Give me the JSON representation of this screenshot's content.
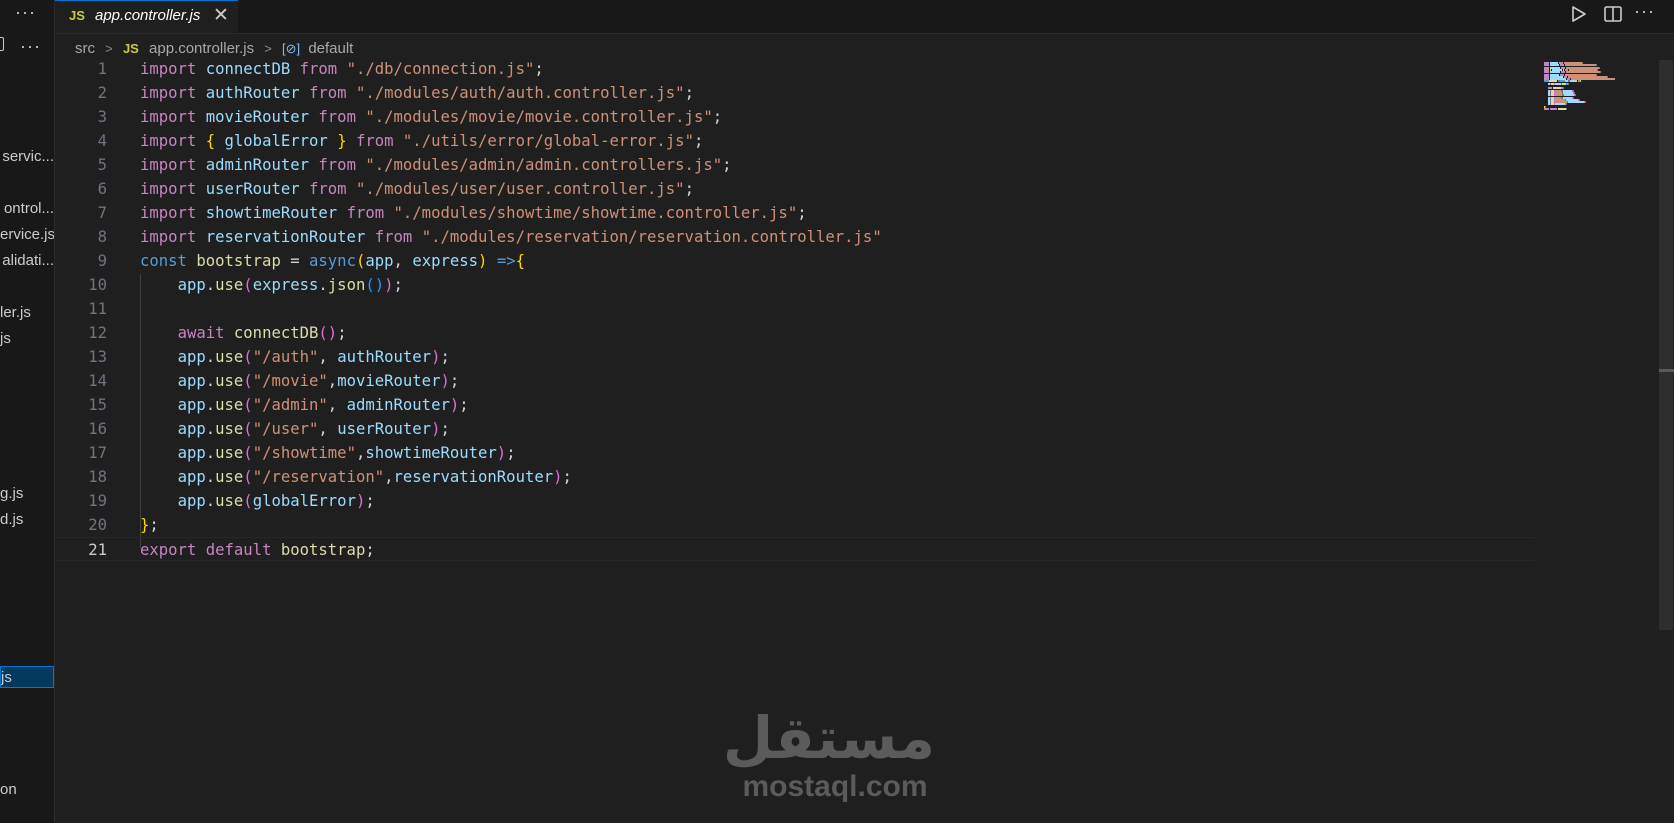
{
  "sidebar": {
    "menu_icon": "ellipsis-icon",
    "items": [
      {
        "label": "servic..."
      },
      {
        "label": "ontrol..."
      },
      {
        "label": "ervice.js"
      },
      {
        "label": "alidati..."
      },
      {
        "label": "ler.js"
      },
      {
        "label": "js"
      },
      {
        "label": "g.js"
      },
      {
        "label": "d.js"
      },
      {
        "label": "js"
      },
      {
        "label": "on"
      }
    ]
  },
  "tab": {
    "icon": "js-file-icon",
    "icon_label": "JS",
    "title": "app.controller.js",
    "close_icon": "close-icon"
  },
  "toolbar": {
    "run_icon": "play-icon",
    "split_icon": "split-editor-icon",
    "more_icon": "ellipsis-icon"
  },
  "breadcrumb": {
    "folder": "src",
    "file_icon_label": "JS",
    "file": "app.controller.js",
    "symbol_icon": "symbol-variable-icon",
    "symbol_glyph": "[⊘]",
    "symbol": "default"
  },
  "editor": {
    "current_line": 21,
    "lines": [
      {
        "n": "1",
        "tokens": [
          [
            "kw",
            "import"
          ],
          [
            "pl",
            " "
          ],
          [
            "var",
            "connectDB"
          ],
          [
            "pl",
            " "
          ],
          [
            "kw",
            "from"
          ],
          [
            "pl",
            " "
          ],
          [
            "str",
            "\"./db/connection.js\""
          ],
          [
            "pl",
            ";"
          ]
        ]
      },
      {
        "n": "2",
        "tokens": [
          [
            "kw",
            "import"
          ],
          [
            "pl",
            " "
          ],
          [
            "var",
            "authRouter"
          ],
          [
            "pl",
            " "
          ],
          [
            "kw",
            "from"
          ],
          [
            "pl",
            " "
          ],
          [
            "str",
            "\"./modules/auth/auth.controller.js\""
          ],
          [
            "pl",
            ";"
          ]
        ]
      },
      {
        "n": "3",
        "tokens": [
          [
            "kw",
            "import"
          ],
          [
            "pl",
            " "
          ],
          [
            "var",
            "movieRouter"
          ],
          [
            "pl",
            " "
          ],
          [
            "kw",
            "from"
          ],
          [
            "pl",
            " "
          ],
          [
            "str",
            "\"./modules/movie/movie.controller.js\""
          ],
          [
            "pl",
            ";"
          ]
        ]
      },
      {
        "n": "4",
        "tokens": [
          [
            "kw",
            "import"
          ],
          [
            "pl",
            " "
          ],
          [
            "p1",
            "{"
          ],
          [
            "pl",
            " "
          ],
          [
            "var",
            "globalError"
          ],
          [
            "pl",
            " "
          ],
          [
            "p1",
            "}"
          ],
          [
            "pl",
            " "
          ],
          [
            "kw",
            "from"
          ],
          [
            "pl",
            " "
          ],
          [
            "str",
            "\"./utils/error/global-error.js\""
          ],
          [
            "pl",
            ";"
          ]
        ]
      },
      {
        "n": "5",
        "tokens": [
          [
            "kw",
            "import"
          ],
          [
            "pl",
            " "
          ],
          [
            "var",
            "adminRouter"
          ],
          [
            "pl",
            " "
          ],
          [
            "kw",
            "from"
          ],
          [
            "pl",
            " "
          ],
          [
            "str",
            "\"./modules/admin/admin.controllers.js\""
          ],
          [
            "pl",
            ";"
          ]
        ]
      },
      {
        "n": "6",
        "tokens": [
          [
            "kw",
            "import"
          ],
          [
            "pl",
            " "
          ],
          [
            "var",
            "userRouter"
          ],
          [
            "pl",
            " "
          ],
          [
            "kw",
            "from"
          ],
          [
            "pl",
            " "
          ],
          [
            "str",
            "\"./modules/user/user.controller.js\""
          ],
          [
            "pl",
            ";"
          ]
        ]
      },
      {
        "n": "7",
        "tokens": [
          [
            "kw",
            "import"
          ],
          [
            "pl",
            " "
          ],
          [
            "var",
            "showtimeRouter"
          ],
          [
            "pl",
            " "
          ],
          [
            "kw",
            "from"
          ],
          [
            "pl",
            " "
          ],
          [
            "str",
            "\"./modules/showtime/showtime.controller.js\""
          ],
          [
            "pl",
            ";"
          ]
        ]
      },
      {
        "n": "8",
        "tokens": [
          [
            "kw",
            "import"
          ],
          [
            "pl",
            " "
          ],
          [
            "var",
            "reservationRouter"
          ],
          [
            "pl",
            " "
          ],
          [
            "kw",
            "from"
          ],
          [
            "pl",
            " "
          ],
          [
            "str",
            "\"./modules/reservation/reservation.controller.js\""
          ]
        ]
      },
      {
        "n": "9",
        "tokens": [
          [
            "dk",
            "const"
          ],
          [
            "pl",
            " "
          ],
          [
            "fn",
            "bootstrap"
          ],
          [
            "pl",
            " = "
          ],
          [
            "dk",
            "async"
          ],
          [
            "p1",
            "("
          ],
          [
            "var",
            "app"
          ],
          [
            "pl",
            ", "
          ],
          [
            "var",
            "express"
          ],
          [
            "p1",
            ")"
          ],
          [
            "pl",
            " "
          ],
          [
            "dk",
            "=>"
          ],
          [
            "p1",
            "{"
          ]
        ]
      },
      {
        "n": "10",
        "tokens": [
          [
            "pl",
            "    "
          ],
          [
            "var",
            "app"
          ],
          [
            "pl",
            "."
          ],
          [
            "fn",
            "use"
          ],
          [
            "p2",
            "("
          ],
          [
            "var",
            "express"
          ],
          [
            "pl",
            "."
          ],
          [
            "fn",
            "json"
          ],
          [
            "p3",
            "()"
          ],
          [
            "p2",
            ")"
          ],
          [
            "pl",
            ";"
          ]
        ]
      },
      {
        "n": "11",
        "tokens": []
      },
      {
        "n": "12",
        "tokens": [
          [
            "pl",
            "    "
          ],
          [
            "kw",
            "await"
          ],
          [
            "pl",
            " "
          ],
          [
            "fn",
            "connectDB"
          ],
          [
            "p2",
            "()"
          ],
          [
            "pl",
            ";"
          ]
        ]
      },
      {
        "n": "13",
        "tokens": [
          [
            "pl",
            "    "
          ],
          [
            "var",
            "app"
          ],
          [
            "pl",
            "."
          ],
          [
            "fn",
            "use"
          ],
          [
            "p2",
            "("
          ],
          [
            "str",
            "\"/auth\""
          ],
          [
            "pl",
            ", "
          ],
          [
            "var",
            "authRouter"
          ],
          [
            "p2",
            ")"
          ],
          [
            "pl",
            ";"
          ]
        ]
      },
      {
        "n": "14",
        "tokens": [
          [
            "pl",
            "    "
          ],
          [
            "var",
            "app"
          ],
          [
            "pl",
            "."
          ],
          [
            "fn",
            "use"
          ],
          [
            "p2",
            "("
          ],
          [
            "str",
            "\"/movie\""
          ],
          [
            "pl",
            ","
          ],
          [
            "var",
            "movieRouter"
          ],
          [
            "p2",
            ")"
          ],
          [
            "pl",
            ";"
          ]
        ]
      },
      {
        "n": "15",
        "tokens": [
          [
            "pl",
            "    "
          ],
          [
            "var",
            "app"
          ],
          [
            "pl",
            "."
          ],
          [
            "fn",
            "use"
          ],
          [
            "p2",
            "("
          ],
          [
            "str",
            "\"/admin\""
          ],
          [
            "pl",
            ", "
          ],
          [
            "var",
            "adminRouter"
          ],
          [
            "p2",
            ")"
          ],
          [
            "pl",
            ";"
          ]
        ]
      },
      {
        "n": "16",
        "tokens": [
          [
            "pl",
            "    "
          ],
          [
            "var",
            "app"
          ],
          [
            "pl",
            "."
          ],
          [
            "fn",
            "use"
          ],
          [
            "p2",
            "("
          ],
          [
            "str",
            "\"/user\""
          ],
          [
            "pl",
            ", "
          ],
          [
            "var",
            "userRouter"
          ],
          [
            "p2",
            ")"
          ],
          [
            "pl",
            ";"
          ]
        ]
      },
      {
        "n": "17",
        "tokens": [
          [
            "pl",
            "    "
          ],
          [
            "var",
            "app"
          ],
          [
            "pl",
            "."
          ],
          [
            "fn",
            "use"
          ],
          [
            "p2",
            "("
          ],
          [
            "str",
            "\"/showtime\""
          ],
          [
            "pl",
            ","
          ],
          [
            "var",
            "showtimeRouter"
          ],
          [
            "p2",
            ")"
          ],
          [
            "pl",
            ";"
          ]
        ]
      },
      {
        "n": "18",
        "tokens": [
          [
            "pl",
            "    "
          ],
          [
            "var",
            "app"
          ],
          [
            "pl",
            "."
          ],
          [
            "fn",
            "use"
          ],
          [
            "p2",
            "("
          ],
          [
            "str",
            "\"/reservation\""
          ],
          [
            "pl",
            ","
          ],
          [
            "var",
            "reservationRouter"
          ],
          [
            "p2",
            ")"
          ],
          [
            "pl",
            ";"
          ]
        ]
      },
      {
        "n": "19",
        "tokens": [
          [
            "pl",
            "    "
          ],
          [
            "var",
            "app"
          ],
          [
            "pl",
            "."
          ],
          [
            "fn",
            "use"
          ],
          [
            "p2",
            "("
          ],
          [
            "var",
            "globalError"
          ],
          [
            "p2",
            ")"
          ],
          [
            "pl",
            ";"
          ]
        ]
      },
      {
        "n": "20",
        "tokens": [
          [
            "p1",
            "}"
          ],
          [
            "pl",
            ";"
          ]
        ]
      },
      {
        "n": "21",
        "tokens": [
          [
            "kw",
            "export"
          ],
          [
            "pl",
            " "
          ],
          [
            "kw",
            "default"
          ],
          [
            "pl",
            " "
          ],
          [
            "fn",
            "bootstrap"
          ],
          [
            "pl",
            ";"
          ]
        ]
      }
    ]
  },
  "watermark": {
    "arabic": "مستقل",
    "latin": "mostaql.com"
  },
  "colors": {
    "background": "#1f1f1f",
    "accent": "#0078d4",
    "keyword": "#c586c0",
    "string": "#ce9178",
    "variable": "#9cdcfe",
    "function": "#dcdcaa",
    "js_badge": "#cbcb41"
  }
}
